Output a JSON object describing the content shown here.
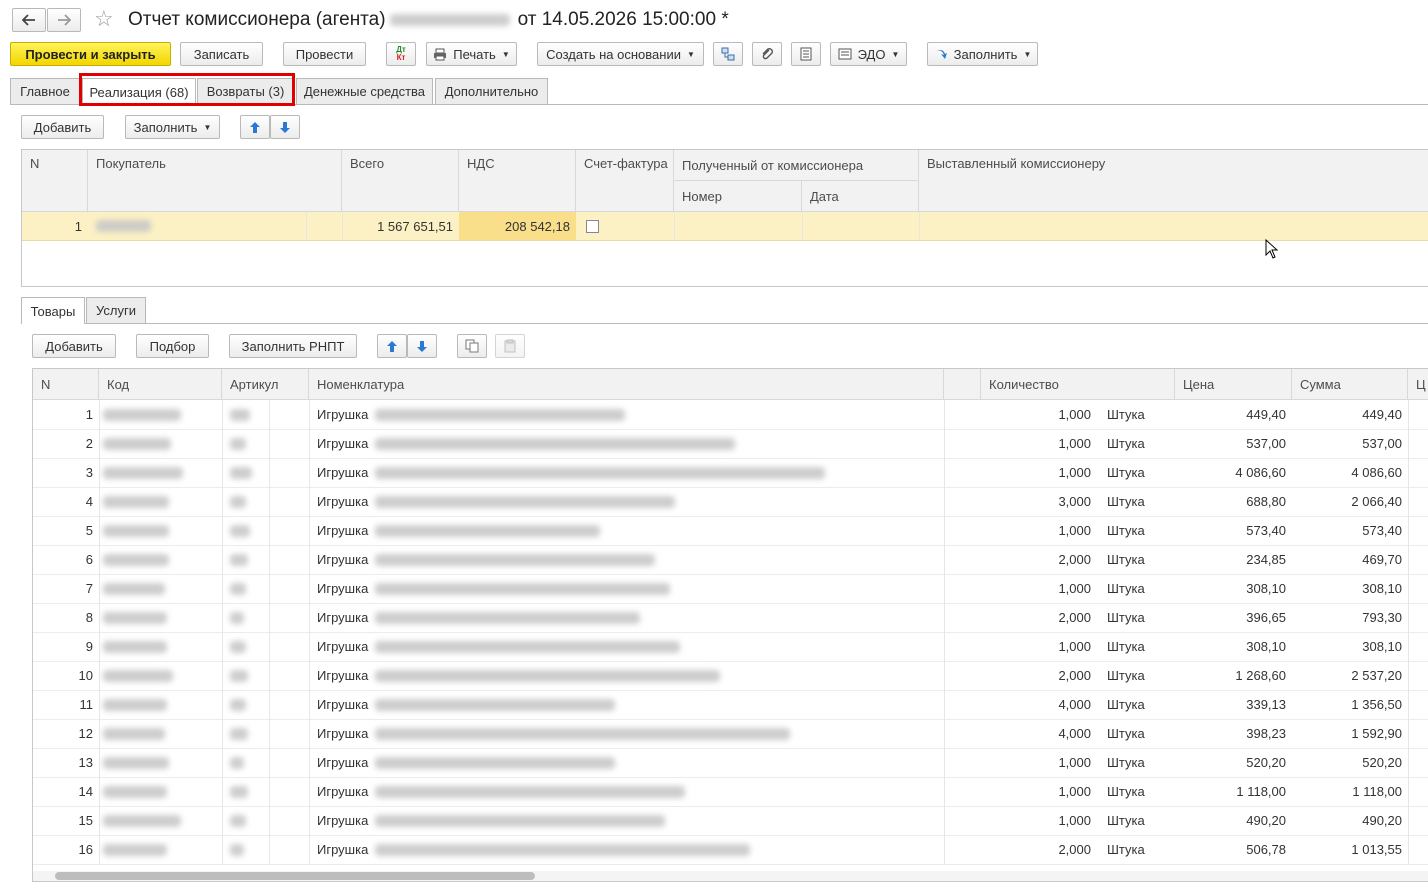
{
  "window": {
    "title_prefix": "Отчет комиссионера (агента)",
    "title_suffix": "от 14.05.2026 15:00:00 *"
  },
  "toolbar": {
    "post_close": "Провести и закрыть",
    "save": "Записать",
    "post": "Провести",
    "dtkt_top": "Дт",
    "dtkt_bottom": "Кт",
    "print": "Печать",
    "create_based": "Создать на основании",
    "edo": "ЭДО",
    "fill": "Заполнить"
  },
  "tabs": [
    {
      "label": "Главное"
    },
    {
      "label": "Реализация (68)"
    },
    {
      "label": "Возвраты (3)"
    },
    {
      "label": "Денежные средства"
    },
    {
      "label": "Дополнительно"
    }
  ],
  "realization_toolbar": {
    "add": "Добавить",
    "fill": "Заполнить"
  },
  "buyers_table": {
    "headers": {
      "n": "N",
      "buyer": "Покупатель",
      "total": "Всего",
      "vat": "НДС",
      "invoice": "Счет-фактура",
      "received": "Полученный от комиссионера",
      "number": "Номер",
      "date": "Дата",
      "issued": "Выставленный комиссионеру"
    },
    "rows": [
      {
        "n": "1",
        "total": "1 567 651,51",
        "vat": "208 542,18"
      }
    ]
  },
  "subtabs": [
    {
      "label": "Товары"
    },
    {
      "label": "Услуги"
    }
  ],
  "goods_toolbar": {
    "add": "Добавить",
    "select": "Подбор",
    "fill_rnpt": "Заполнить РНПТ"
  },
  "goods_table": {
    "headers": {
      "n": "N",
      "code": "Код",
      "article": "Артикул",
      "nomenclature": "Номенклатура",
      "qty": "Количество",
      "price": "Цена",
      "sum": "Сумма",
      "extra": "Ц"
    },
    "rows": [
      {
        "n": "1",
        "name": "Игрушка",
        "qty": "1,000",
        "unit": "Штука",
        "price": "449,40",
        "sum": "449,40"
      },
      {
        "n": "2",
        "name": "Игрушка",
        "qty": "1,000",
        "unit": "Штука",
        "price": "537,00",
        "sum": "537,00"
      },
      {
        "n": "3",
        "name": "Игрушка",
        "qty": "1,000",
        "unit": "Штука",
        "price": "4 086,60",
        "sum": "4 086,60"
      },
      {
        "n": "4",
        "name": "Игрушка",
        "qty": "3,000",
        "unit": "Штука",
        "price": "688,80",
        "sum": "2 066,40"
      },
      {
        "n": "5",
        "name": "Игрушка",
        "qty": "1,000",
        "unit": "Штука",
        "price": "573,40",
        "sum": "573,40"
      },
      {
        "n": "6",
        "name": "Игрушка",
        "qty": "2,000",
        "unit": "Штука",
        "price": "234,85",
        "sum": "469,70"
      },
      {
        "n": "7",
        "name": "Игрушка",
        "qty": "1,000",
        "unit": "Штука",
        "price": "308,10",
        "sum": "308,10"
      },
      {
        "n": "8",
        "name": "Игрушка",
        "qty": "2,000",
        "unit": "Штука",
        "price": "396,65",
        "sum": "793,30"
      },
      {
        "n": "9",
        "name": "Игрушка",
        "qty": "1,000",
        "unit": "Штука",
        "price": "308,10",
        "sum": "308,10"
      },
      {
        "n": "10",
        "name": "Игрушка",
        "qty": "2,000",
        "unit": "Штука",
        "price": "1 268,60",
        "sum": "2 537,20"
      },
      {
        "n": "11",
        "name": "Игрушка",
        "qty": "4,000",
        "unit": "Штука",
        "price": "339,13",
        "sum": "1 356,50"
      },
      {
        "n": "12",
        "name": "Игрушка",
        "qty": "4,000",
        "unit": "Штука",
        "price": "398,23",
        "sum": "1 592,90"
      },
      {
        "n": "13",
        "name": "Игрушка",
        "qty": "1,000",
        "unit": "Штука",
        "price": "520,20",
        "sum": "520,20"
      },
      {
        "n": "14",
        "name": "Игрушка",
        "qty": "1,000",
        "unit": "Штука",
        "price": "1 118,00",
        "sum": "1 118,00"
      },
      {
        "n": "15",
        "name": "Игрушка",
        "qty": "1,000",
        "unit": "Штука",
        "price": "490,20",
        "sum": "490,20"
      },
      {
        "n": "16",
        "name": "Игрушка",
        "qty": "2,000",
        "unit": "Штука",
        "price": "506,78",
        "sum": "1 013,55"
      }
    ]
  },
  "colors": {
    "primary_button": "#f2d600",
    "highlight_row": "#fcf1c4",
    "vat_cell": "#f9df8a",
    "annotation_frame": "#e00000",
    "icon_blue": "#2a7ad3"
  }
}
